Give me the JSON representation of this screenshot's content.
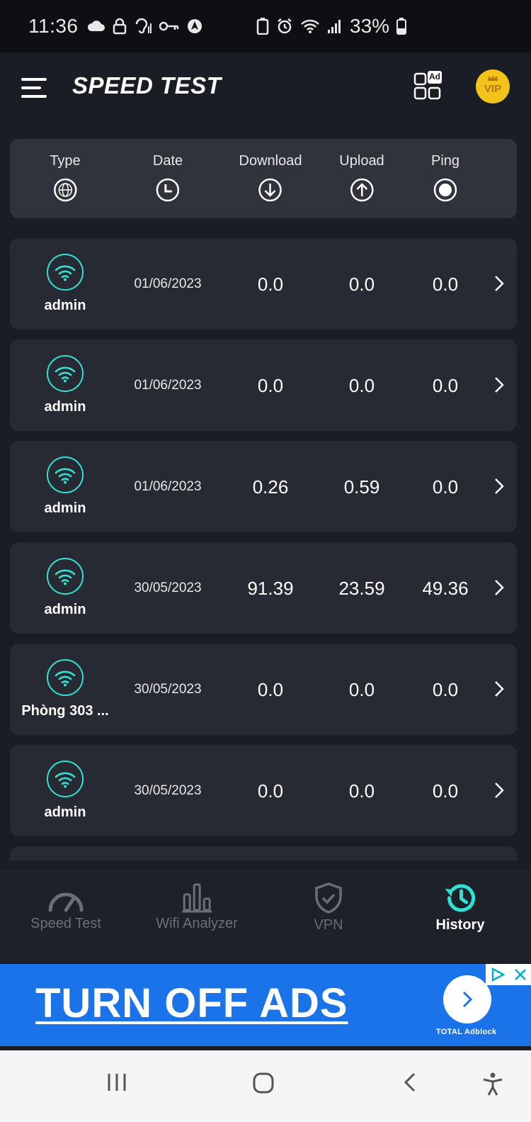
{
  "status_bar": {
    "time": "11:36",
    "battery_percent": "33%"
  },
  "header": {
    "title": "SPEED TEST",
    "vip_label": "VIP",
    "ad_badge": "Ad"
  },
  "columns": [
    {
      "label": "Type",
      "icon": "globe-icon"
    },
    {
      "label": "Date",
      "icon": "clock-icon"
    },
    {
      "label": "Download",
      "icon": "download-arrow-icon"
    },
    {
      "label": "Upload",
      "icon": "upload-arrow-icon"
    },
    {
      "label": "Ping",
      "icon": "ping-dot-icon"
    }
  ],
  "history": [
    {
      "name": "admin",
      "date": "01/06/2023",
      "download": "0.0",
      "upload": "0.0",
      "ping": "0.0"
    },
    {
      "name": "admin",
      "date": "01/06/2023",
      "download": "0.0",
      "upload": "0.0",
      "ping": "0.0"
    },
    {
      "name": "admin",
      "date": "01/06/2023",
      "download": "0.26",
      "upload": "0.59",
      "ping": "0.0"
    },
    {
      "name": "admin",
      "date": "30/05/2023",
      "download": "91.39",
      "upload": "23.59",
      "ping": "49.36"
    },
    {
      "name": "Phòng 303 ...",
      "date": "30/05/2023",
      "download": "0.0",
      "upload": "0.0",
      "ping": "0.0"
    },
    {
      "name": "admin",
      "date": "30/05/2023",
      "download": "0.0",
      "upload": "0.0",
      "ping": "0.0"
    }
  ],
  "bottom_nav": [
    {
      "label": "Speed Test",
      "icon": "speedometer-icon",
      "active": false
    },
    {
      "label": "Wifi Analyzer",
      "icon": "bar-chart-icon",
      "active": false
    },
    {
      "label": "VPN",
      "icon": "shield-check-icon",
      "active": false
    },
    {
      "label": "History",
      "icon": "history-icon",
      "active": true
    }
  ],
  "ad": {
    "text": "TURN OFF ADS",
    "brand": "TOTAL Adblock"
  },
  "colors": {
    "accent": "#2ee3d5",
    "background": "#1b1d24",
    "card": "#272a32",
    "ad_blue": "#1a73e8",
    "vip_gold": "#f2c318"
  }
}
